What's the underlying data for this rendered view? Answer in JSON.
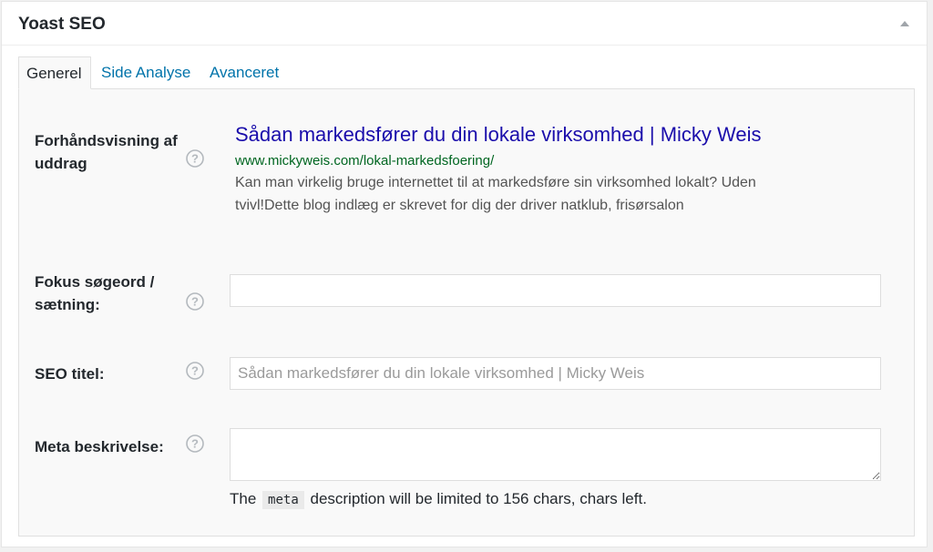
{
  "metabox": {
    "title": "Yoast SEO"
  },
  "tabs": [
    {
      "label": "Generel",
      "active": true
    },
    {
      "label": "Side Analyse",
      "active": false
    },
    {
      "label": "Avanceret",
      "active": false
    }
  ],
  "snippet_preview": {
    "label": "Forhåndsvisning af uddrag",
    "title": "Sådan markedsfører du din lokale virksomhed | Micky Weis",
    "url": "www.mickyweis.com/lokal-markedsfoering/",
    "description": "Kan man virkelig bruge internettet til at markedsføre sin virksomhed lokalt? Uden tvivl!Dette blog indlæg er skrevet for dig der driver natklub, frisørsalon"
  },
  "focus_keyword": {
    "label": "Fokus søgeord / sætning:",
    "value": "",
    "placeholder": ""
  },
  "seo_title": {
    "label": "SEO titel:",
    "value": "",
    "placeholder": "Sådan markedsfører du din lokale virksomhed | Micky Weis"
  },
  "meta_description": {
    "label": "Meta beskrivelse:",
    "value": "",
    "note_before": "The",
    "note_code": "meta",
    "note_after": "description will be limited to 156 chars, chars left."
  },
  "icons": {
    "help": "help-question-icon",
    "collapse": "triangle-up-icon"
  },
  "colors": {
    "link": "#0073aa",
    "snippet_title": "#1a0dab",
    "snippet_url": "#006621",
    "snippet_desc": "#545454"
  }
}
